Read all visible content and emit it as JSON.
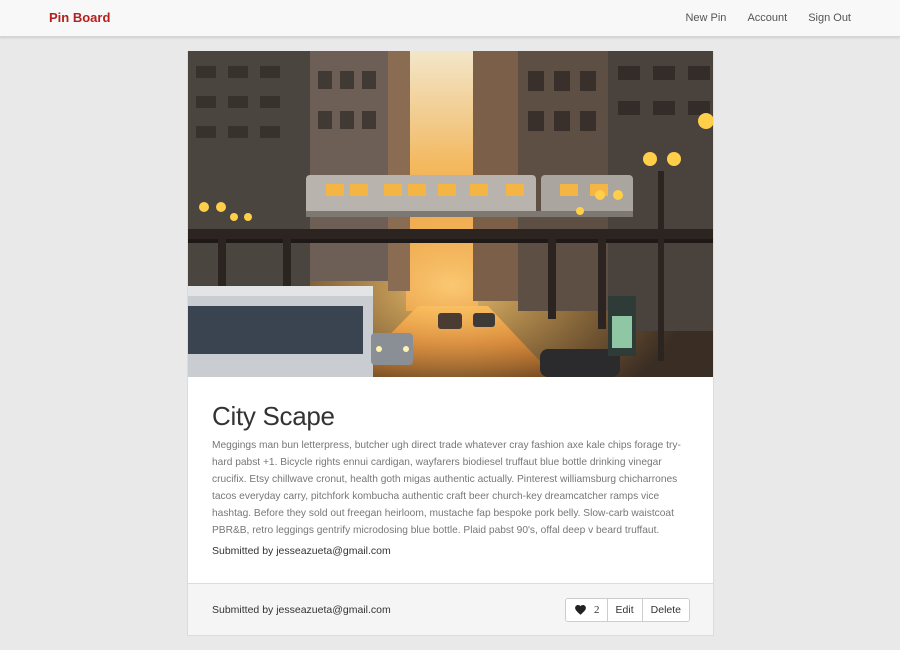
{
  "navbar": {
    "brand": "Pin Board",
    "links": [
      "New Pin",
      "Account",
      "Sign Out"
    ]
  },
  "pin": {
    "image": {
      "icon": "city-photo",
      "alt": ""
    },
    "title": "City Scape",
    "description": "Meggings man bun letterpress, butcher ugh direct trade whatever cray fashion axe kale chips forage try-hard pabst +1. Bicycle rights ennui cardigan, wayfarers biodiesel truffaut blue bottle drinking vinegar crucifix. Etsy chillwave cronut, health goth migas authentic actually. Pinterest williamsburg chicharrones tacos everyday carry, pitchfork kombucha authentic craft beer church-key dreamcatcher ramps vice hashtag. Before they sold out freegan heirloom, mustache fap bespoke pork belly. Slow-carb waistcoat PBR&B, retro leggings gentrify microdosing blue bottle. Plaid pabst 90's, offal deep v beard truffaut.",
    "submitted_by": "Submitted by jesseazueta@gmail.com"
  },
  "footer": {
    "submitted_by": "Submitted by jesseazueta@gmail.com",
    "like_icon": "heart-icon",
    "like_count": "2",
    "edit_label": "Edit",
    "delete_label": "Delete"
  },
  "colors": {
    "brand": "#b4201e",
    "background": "#e9e9e9",
    "navbar": "#f8f8f8",
    "card": "#ffffff",
    "footer": "#f5f5f5"
  }
}
